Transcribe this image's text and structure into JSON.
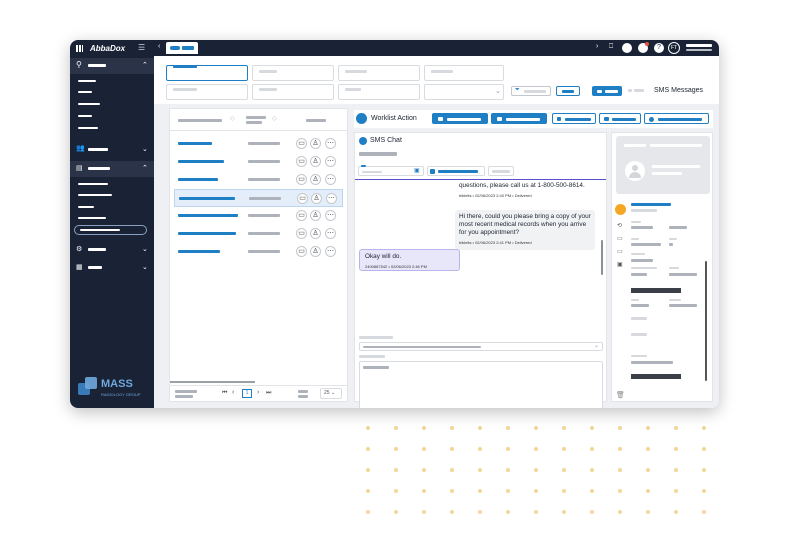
{
  "app": {
    "logo_text": "AbbaDox"
  },
  "brand": {
    "name": "MASS",
    "sub": "RADIOLOGY GROUP"
  },
  "toolbar": {
    "sms_messages_label": "SMS Messages"
  },
  "worklist": {
    "title": "Worklist Action"
  },
  "chat": {
    "title": "SMS Chat",
    "messages": [
      {
        "text": "questions, please call us at 1-800-500-8614.",
        "meta": "triklelts • 02/06/2023 2:40 PM • Delivered"
      },
      {
        "text": "Hi there, could you please bring a copy of your most recent medical records when you arrive for you appointment?",
        "meta": "triklelts • 02/06/2023 2:41 PM • Delivered"
      },
      {
        "text": "Okay will do.",
        "meta": "2400887542 • 02/06/2023 2:46 PM"
      }
    ]
  },
  "pagination": {
    "current_page": "1",
    "page_size": "25"
  },
  "user": {
    "initials": "FT"
  },
  "colors": {
    "sidebar": "#1a2236",
    "accent": "#1f7fc4",
    "danger": "#e0553d",
    "highlight": "#f5a623"
  }
}
